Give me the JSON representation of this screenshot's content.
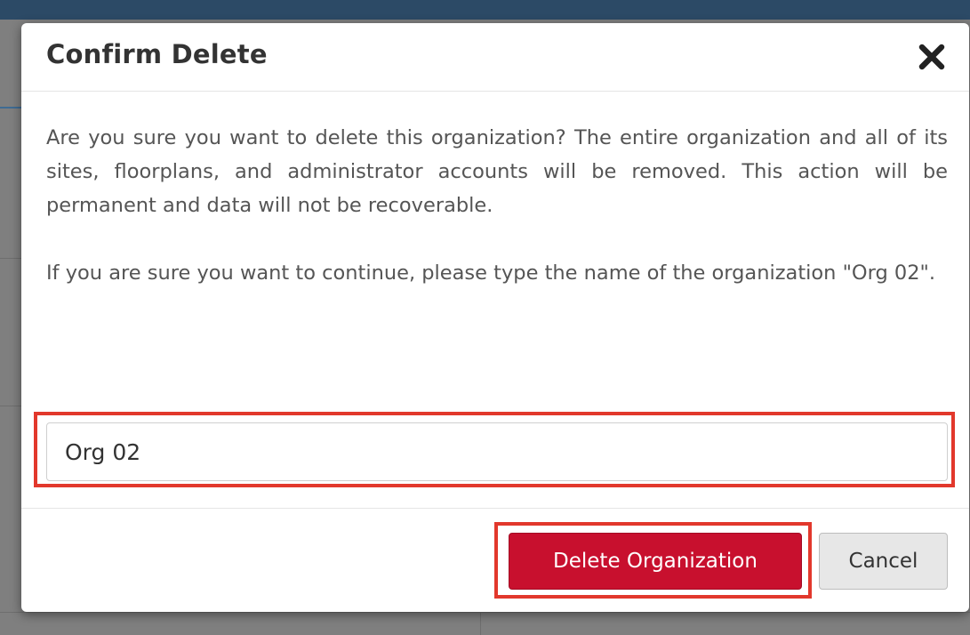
{
  "modal": {
    "title": "Confirm Delete",
    "close_icon": "close-icon",
    "body": {
      "paragraph_1": "Are you sure you want to delete this organization? The entire organization and all of its sites, floorplans, and administrator accounts will be removed. This action will be permanent and data will not be recoverable.",
      "paragraph_2": "If you are sure you want to continue, please type the name of the organization \"Org 02\"."
    },
    "confirm_input": {
      "value": "Org 02"
    },
    "footer": {
      "delete_label": "Delete Organization",
      "cancel_label": "Cancel"
    }
  },
  "colors": {
    "danger": "#c8102e",
    "highlight": "#e2382c",
    "backdrop": "#7f7f7f"
  }
}
